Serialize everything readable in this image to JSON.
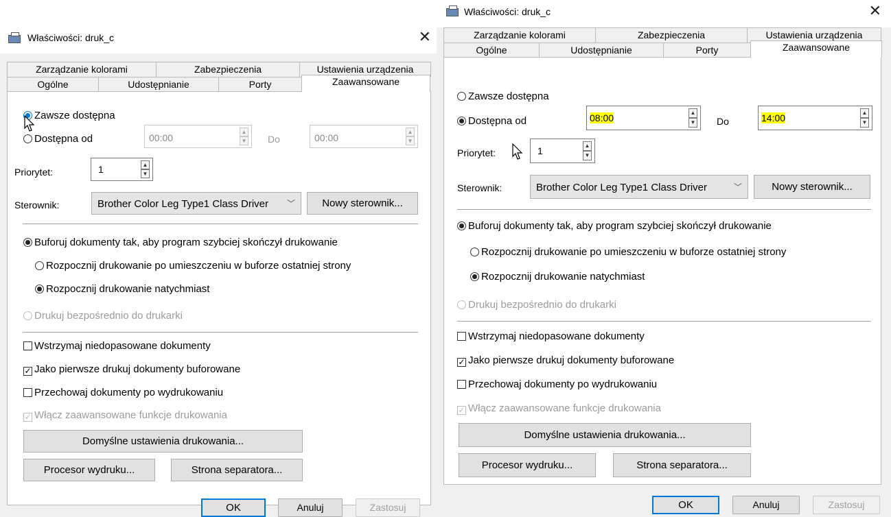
{
  "left_dialog": {
    "title": "Właściwości: druk_c",
    "tabs_top": [
      "Zarządzanie kolorami",
      "Zabezpieczenia",
      "Ustawienia urządzenia"
    ],
    "tabs_bottom": [
      "Ogólne",
      "Udostępnianie",
      "Porty",
      "Zaawansowane"
    ],
    "availability": {
      "always_label": "Zawsze dostępna",
      "always_selected": true,
      "from_label": "Dostępna od",
      "from_selected": false,
      "from_time": "00:00",
      "to_label": "Do",
      "to_time": "00:00"
    },
    "priority_label": "Priorytet:",
    "priority_value": "1",
    "driver_label": "Sterownik:",
    "driver_value": "Brother Color Leg Type1 Class Driver",
    "new_driver_button": "Nowy sterownik...",
    "spool_label": "Buforuj dokumenty tak, aby program szybciej skończył drukowanie",
    "spool_after_last_label": "Rozpocznij drukowanie po umieszczeniu w buforze ostatniej strony",
    "spool_immediately_label": "Rozpocznij drukowanie natychmiast",
    "direct_print_label": "Drukuj bezpośrednio do drukarki",
    "hold_mismatched_label": "Wstrzymaj niedopasowane dokumenty",
    "hold_mismatched_checked": false,
    "spooled_first_label": "Jako pierwsze drukuj dokumenty buforowane",
    "spooled_first_checked": true,
    "keep_printed_label": "Przechowaj dokumenty po wydrukowaniu",
    "keep_printed_checked": false,
    "advanced_features_label": "Włącz zaawansowane funkcje drukowania",
    "advanced_features_checked": true,
    "defaults_button": "Domyślne ustawienia drukowania...",
    "processor_button": "Procesor wydruku...",
    "separator_button": "Strona separatora...",
    "ok_button": "OK",
    "cancel_button": "Anuluj",
    "apply_button": "Zastosuj"
  },
  "right_dialog": {
    "title": "Właściwości: druk_c",
    "tabs_top": [
      "Zarządzanie kolorami",
      "Zabezpieczenia",
      "Ustawienia urządzenia"
    ],
    "tabs_bottom": [
      "Ogólne",
      "Udostępnianie",
      "Porty",
      "Zaawansowane"
    ],
    "availability": {
      "always_label": "Zawsze dostępna",
      "always_selected": false,
      "from_label": "Dostępna od",
      "from_selected": true,
      "from_time": "08:00",
      "to_label": "Do",
      "to_time": "14:00"
    },
    "priority_label": "Priorytet:",
    "priority_value": "1",
    "driver_label": "Sterownik:",
    "driver_value": "Brother Color Leg Type1 Class Driver",
    "new_driver_button": "Nowy sterownik...",
    "spool_label": "Buforuj dokumenty tak, aby program szybciej skończył drukowanie",
    "spool_after_last_label": "Rozpocznij drukowanie po umieszczeniu w buforze ostatniej strony",
    "spool_immediately_label": "Rozpocznij drukowanie natychmiast",
    "direct_print_label": "Drukuj bezpośrednio do drukarki",
    "hold_mismatched_label": "Wstrzymaj niedopasowane dokumenty",
    "hold_mismatched_checked": false,
    "spooled_first_label": "Jako pierwsze drukuj dokumenty buforowane",
    "spooled_first_checked": true,
    "keep_printed_label": "Przechowaj dokumenty po wydrukowaniu",
    "keep_printed_checked": false,
    "advanced_features_label": "Włącz zaawansowane funkcje drukowania",
    "advanced_features_checked": true,
    "defaults_button": "Domyślne ustawienia drukowania...",
    "processor_button": "Procesor wydruku...",
    "separator_button": "Strona separatora...",
    "ok_button": "OK",
    "cancel_button": "Anuluj",
    "apply_button": "Zastosuj"
  },
  "colors": {
    "highlight": "#ffff00",
    "focus_blue": "#0078d7",
    "dialog_bg": "#f0f0f0"
  }
}
